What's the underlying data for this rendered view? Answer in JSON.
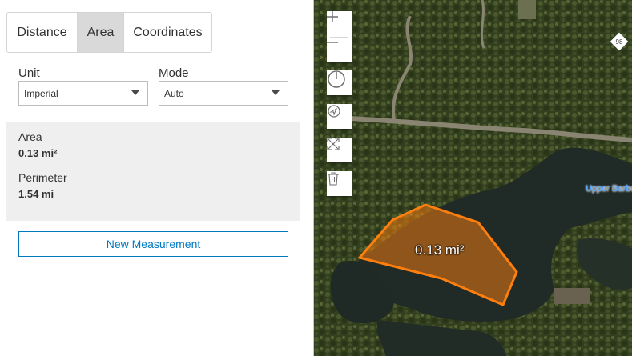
{
  "tabs": [
    {
      "label": "Distance",
      "active": false
    },
    {
      "label": "Area",
      "active": true
    },
    {
      "label": "Coordinates",
      "active": false
    }
  ],
  "unit": {
    "label": "Unit",
    "selected": "Imperial"
  },
  "mode": {
    "label": "Mode",
    "selected": "Auto"
  },
  "results": {
    "area_label": "Area",
    "area_value": "0.13 mi²",
    "perimeter_label": "Perimeter",
    "perimeter_value": "1.54 mi"
  },
  "new_measurement_label": "New Measurement",
  "map": {
    "area_label": "0.13 mi²",
    "lake_label": "Upper Barbe",
    "route_shield": "98",
    "polygon_color": "#ff7f0e"
  }
}
